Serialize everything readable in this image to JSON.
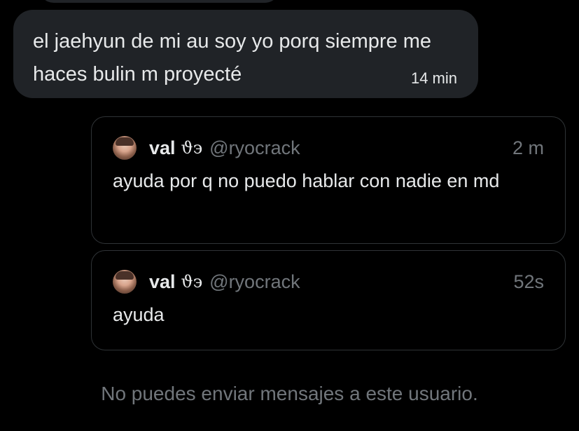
{
  "message": {
    "text": "el jaehyun de mi au soy yo porq siempre me haces bulin m proyecté",
    "time": "14 min"
  },
  "quotes": [
    {
      "name": "val",
      "glyph": "ϑ϶",
      "handle": "@ryocrack",
      "time": "2 m",
      "text": "ayuda por q no puedo hablar con nadie en md"
    },
    {
      "name": "val",
      "glyph": "ϑ϶",
      "handle": "@ryocrack",
      "time": "52s",
      "text": "ayuda"
    }
  ],
  "notice": "No puedes enviar mensajes a este usuario.",
  "colors": {
    "background": "#000000",
    "bubble": "#202327",
    "text": "#e7e9ea",
    "muted": "#71767b",
    "border": "#2f3336"
  },
  "icons": {
    "avatar": "user-avatar"
  }
}
